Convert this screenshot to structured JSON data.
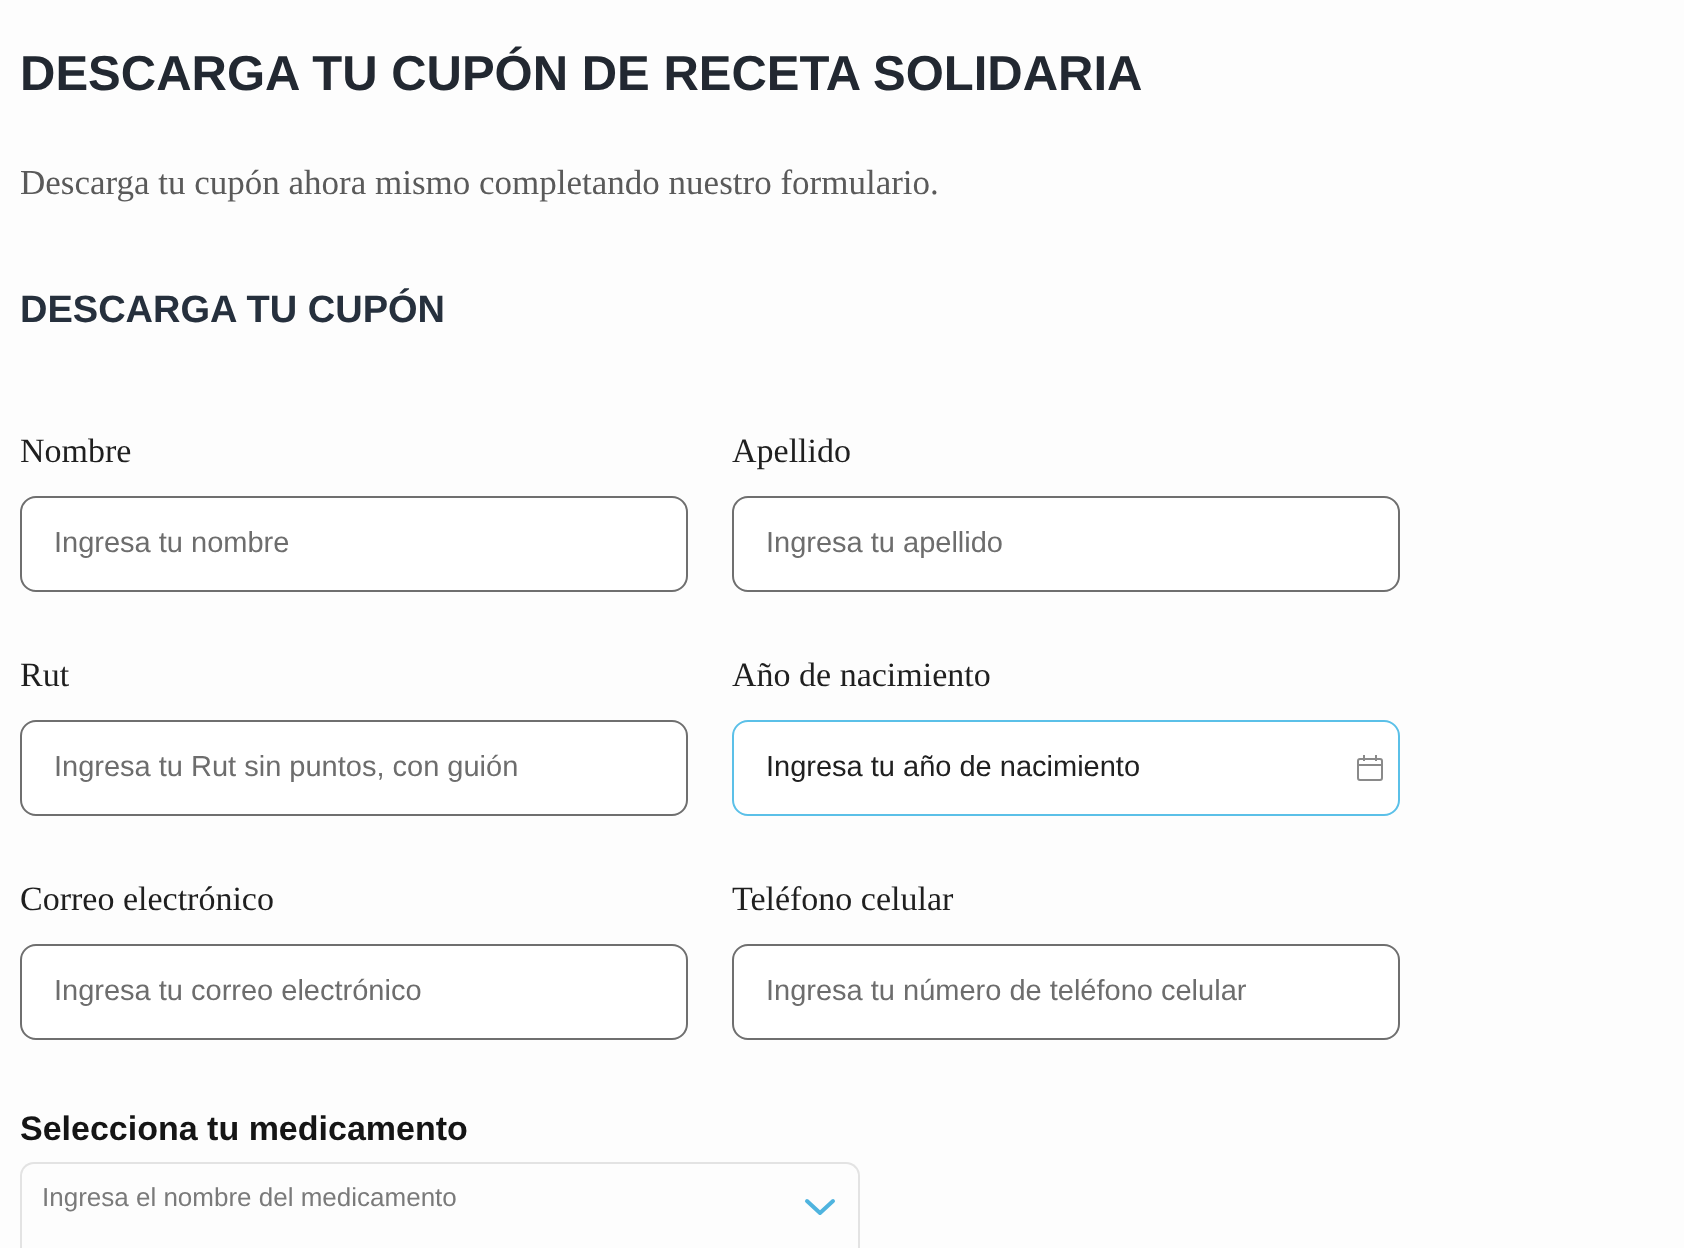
{
  "page": {
    "title": "DESCARGA TU CUPÓN DE RECETA SOLIDARIA",
    "intro": "Descarga tu cupón ahora mismo completando nuestro formulario."
  },
  "form": {
    "heading": "DESCARGA TU CUPÓN",
    "fields": [
      {
        "label": "Nombre",
        "placeholder": "Ingresa tu nombre",
        "kind": "text",
        "focused": false
      },
      {
        "label": "Apellido",
        "placeholder": "Ingresa tu apellido",
        "kind": "text",
        "focused": false
      },
      {
        "label": "Rut",
        "placeholder": "Ingresa tu Rut sin puntos, con guión",
        "kind": "text",
        "focused": false
      },
      {
        "label": "Año de nacimiento",
        "placeholder": "Ingresa tu año de nacimiento",
        "kind": "date",
        "focused": true
      },
      {
        "label": "Correo electrónico",
        "placeholder": "Ingresa tu correo electrónico",
        "kind": "text",
        "focused": false
      },
      {
        "label": "Teléfono celular",
        "placeholder": "Ingresa tu número de teléfono celular",
        "kind": "text",
        "focused": false
      }
    ]
  },
  "medication": {
    "label": "Selecciona tu medicamento",
    "placeholder": "Ingresa el nombre del medicamento"
  }
}
